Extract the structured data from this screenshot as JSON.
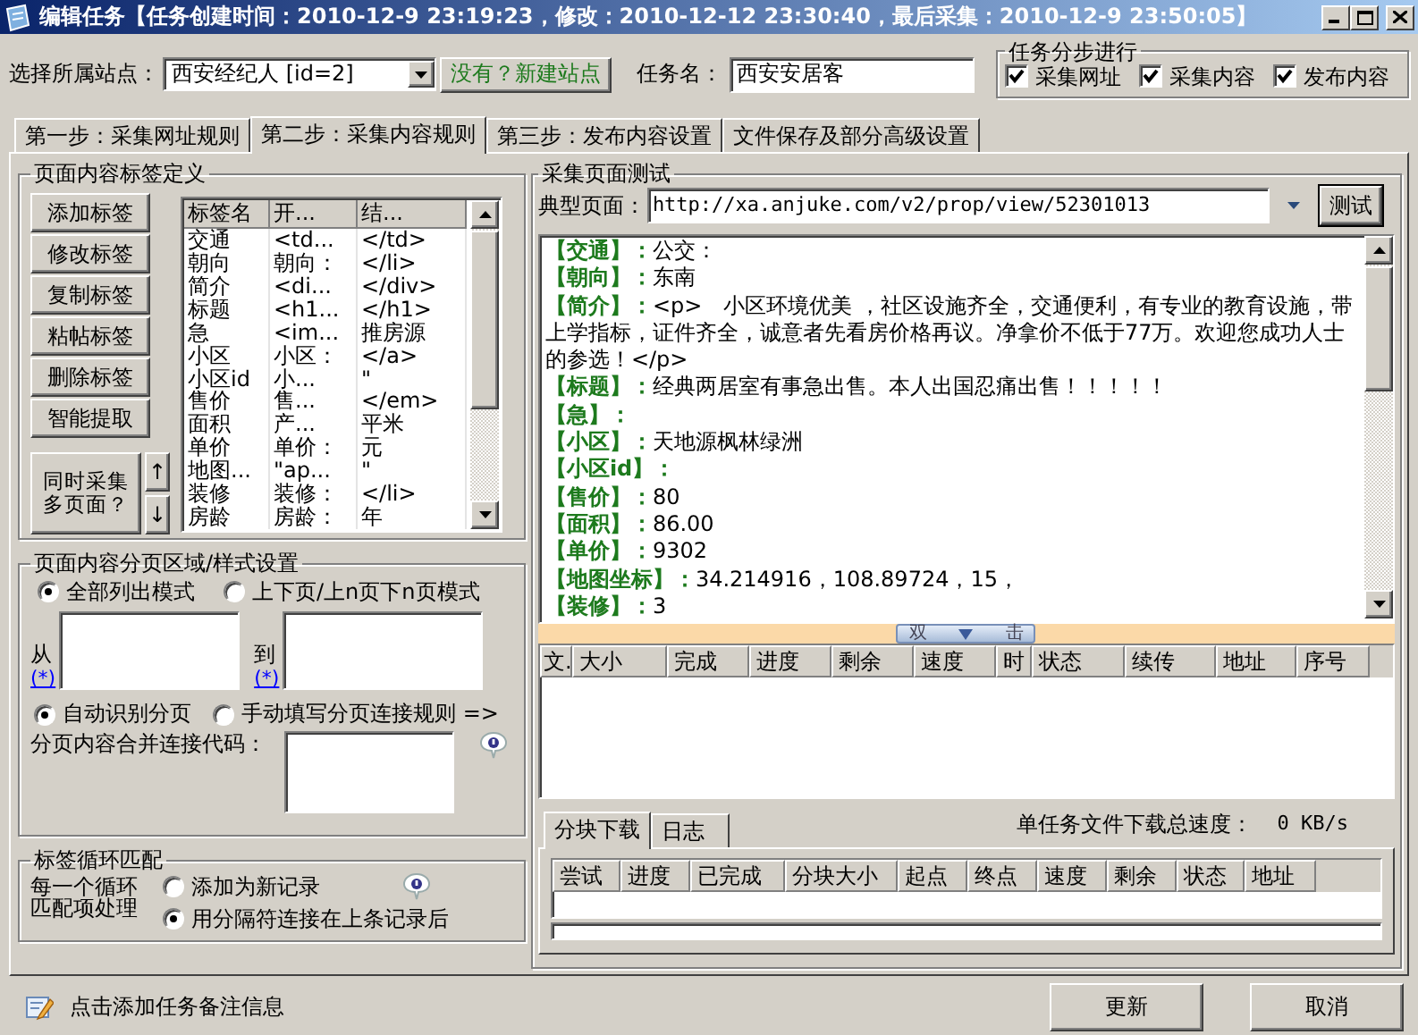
{
  "window": {
    "title": "编辑任务【任务创建时间：2010-12-9 23:19:23，修改：2010-12-12 23:30:40，最后采集：2010-12-9 23:50:05】"
  },
  "site": {
    "label": "选择所属站点：",
    "value": "西安经纪人 [id=2]",
    "new_site_button": "没有？新建站点"
  },
  "task_name": {
    "label": "任务名：",
    "value": "西安安居客"
  },
  "steps": {
    "title": "任务分步进行",
    "items": [
      {
        "label": "采集网址",
        "checked": true
      },
      {
        "label": "采集内容",
        "checked": true
      },
      {
        "label": "发布内容",
        "checked": true
      }
    ]
  },
  "tabs": [
    {
      "label": "第一步：采集网址规则",
      "selected": false
    },
    {
      "label": "第二步：采集内容规则",
      "selected": true
    },
    {
      "label": "第三步：发布内容设置",
      "selected": false
    },
    {
      "label": "文件保存及部分高级设置",
      "selected": false
    }
  ],
  "tag_definition": {
    "title": "页面内容标签定义",
    "buttons": [
      "添加标签",
      "修改标签",
      "复制标签",
      "粘帖标签",
      "删除标签",
      "智能提取"
    ],
    "multi_page_button": "同时采集多页面？",
    "move_up": "↑",
    "move_down": "↓",
    "columns": [
      "标签名",
      "开...",
      "结..."
    ],
    "rows": [
      [
        "交通",
        "<td...",
        "</td>"
      ],
      [
        "朝向",
        "朝向：",
        "</li>"
      ],
      [
        "简介",
        "<di...",
        "</div>"
      ],
      [
        "标题",
        "<h1...",
        "</h1>"
      ],
      [
        "急",
        "<im...",
        "推房源"
      ],
      [
        "小区",
        "小区：",
        "</a>"
      ],
      [
        "小区id",
        "小...",
        "\""
      ],
      [
        "售价",
        "售...",
        "</em>"
      ],
      [
        "面积",
        "产...",
        "平米"
      ],
      [
        "单价",
        "单价：",
        "元"
      ],
      [
        "地图...",
        "\"ap...",
        "\""
      ],
      [
        "装修",
        "装修：",
        "</li>"
      ],
      [
        "房龄",
        "房龄：",
        "年"
      ]
    ]
  },
  "pagination": {
    "title": "页面内容分页区域/样式设置",
    "modes": [
      {
        "label": "全部列出模式",
        "selected": true
      },
      {
        "label": "上下页/上n页下n页模式",
        "selected": false
      }
    ],
    "from_label": "从",
    "to_label": "到",
    "wildcard_links": [
      "(*)",
      "(*)"
    ],
    "detect": [
      {
        "label": "自动识别分页",
        "selected": true
      },
      {
        "label": "手动填写分页连接规则 =>",
        "selected": false
      }
    ],
    "merge_label": "分页内容合并连接代码："
  },
  "loop_match": {
    "title": "标签循环匹配",
    "label": "每一个循环匹配项处理",
    "options": [
      {
        "label": "添加为新记录",
        "selected": false
      },
      {
        "label": "用分隔符连接在上条记录后",
        "selected": true
      }
    ]
  },
  "test": {
    "title": "采集页面测试",
    "url_label": "典型页面：",
    "url": "http://xa.anjuke.com/v2/prop/view/52301013",
    "test_button": "测试",
    "results": [
      {
        "label": "【交通】：",
        "value": "公交："
      },
      {
        "label": "【朝向】：",
        "value": "东南"
      },
      {
        "label": "【简介】：",
        "value": "<p>　小区环境优美 ，社区设施齐全，交通便利，有专业的教育设施，带上学指标，证件齐全，诚意者先看房价格再议。净拿价不低于77万。欢迎您成功人士的参选！</p>"
      },
      {
        "label": "【标题】：",
        "value": "经典两居室有事急出售。本人出国忍痛出售！！！！！"
      },
      {
        "label": "【急】："
      },
      {
        "label": "【小区】：",
        "value": "天地源枫林绿洲"
      },
      {
        "label": "【小区id】："
      },
      {
        "label": "【售价】：",
        "value": "80"
      },
      {
        "label": "【面积】：",
        "value": "86.00"
      },
      {
        "label": "【单价】：",
        "value": "9302"
      },
      {
        "label": "【地图坐标】：",
        "value": "34.214916，108.89724，15，"
      },
      {
        "label": "【装修】：",
        "value": "3"
      }
    ]
  },
  "splitter": {
    "left": "双",
    "right": "击"
  },
  "download_table": {
    "columns": [
      "文.",
      "大小",
      "完成",
      "进度",
      "剩余",
      "速度",
      "时",
      "状态",
      "续传",
      "地址",
      "序号"
    ]
  },
  "lower_tabs": [
    {
      "label": "分块下载",
      "selected": true
    },
    {
      "label": "日志",
      "selected": false
    }
  ],
  "speed": {
    "label": "单任务文件下载总速度：",
    "value": "0 KB/s"
  },
  "block_table": {
    "columns": [
      "尝试",
      "进度",
      "已完成",
      "分块大小",
      "起点",
      "终点",
      "速度",
      "剩余",
      "状态",
      "地址"
    ]
  },
  "note": "点击添加任务备注信息",
  "buttons": [
    "更新",
    "取消"
  ]
}
